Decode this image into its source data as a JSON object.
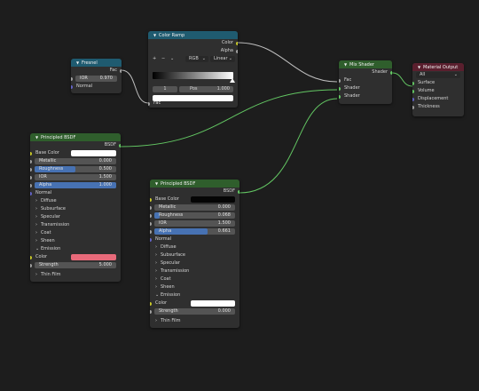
{
  "colors": {
    "yellow_socket": "#c7c729",
    "green_socket": "#63c763",
    "gray_socket": "#a1a1a1",
    "purple_socket": "#6363c7",
    "wire": "#bfbfbf",
    "header_converter": "#1f5b70",
    "header_shader": "#2f5e2c",
    "header_output": "#5a1f2e",
    "accent": "#4772b3",
    "emission_color": "#e86a7a"
  },
  "fresnel": {
    "title": "Fresnel",
    "out_fac": "Fac",
    "ior_label": "IOR",
    "ior_value": "0.970",
    "normal": "Normal"
  },
  "color_ramp": {
    "title": "Color Ramp",
    "out_color": "Color",
    "out_alpha": "Alpha",
    "add": "+",
    "remove": "−",
    "more": "⌄",
    "color_mode": "RGB",
    "interpolation": "Linear",
    "stop_index": "1",
    "pos_label": "Pos",
    "pos_value": "1.000",
    "in_fac": "Fac"
  },
  "mix_shader": {
    "title": "Mix Shader",
    "out_shader": "Shader",
    "in_fac": "Fac",
    "in_shader1": "Shader",
    "in_shader2": "Shader"
  },
  "material_output": {
    "title": "Material Output",
    "target": "All",
    "surface": "Surface",
    "volume": "Volume",
    "displacement": "Displacement",
    "thickness": "Thickness"
  },
  "bsdf1": {
    "title": "Principled BSDF",
    "out": "BSDF",
    "base_color": "Base Color",
    "metallic_label": "Metallic",
    "metallic": "0.000",
    "metallic_frac": 0,
    "roughness_label": "Roughness",
    "roughness": "0.500",
    "roughness_frac": 0.5,
    "ior_label": "IOR",
    "ior": "1.500",
    "alpha_label": "Alpha",
    "alpha": "1.000",
    "alpha_frac": 1,
    "normal": "Normal",
    "panels": [
      "Diffuse",
      "Subsurface",
      "Specular",
      "Transmission",
      "Coat",
      "Sheen",
      "Emission"
    ],
    "emission_color": "Color",
    "strength_label": "Strength",
    "strength": "5.000",
    "thin_film": "Thin Film"
  },
  "bsdf2": {
    "title": "Principled BSDF",
    "out": "BSDF",
    "base_color": "Base Color",
    "metallic_label": "Metallic",
    "metallic": "0.000",
    "metallic_frac": 0,
    "roughness_label": "Roughness",
    "roughness": "0.068",
    "roughness_frac": 0.068,
    "ior_label": "IOR",
    "ior": "1.500",
    "alpha_label": "Alpha",
    "alpha": "0.661",
    "alpha_frac": 0.661,
    "normal": "Normal",
    "panels": [
      "Diffuse",
      "Subsurface",
      "Specular",
      "Transmission",
      "Coat",
      "Sheen",
      "Emission"
    ],
    "emission_color": "Color",
    "strength_label": "Strength",
    "strength": "0.000",
    "thin_film": "Thin Film"
  }
}
